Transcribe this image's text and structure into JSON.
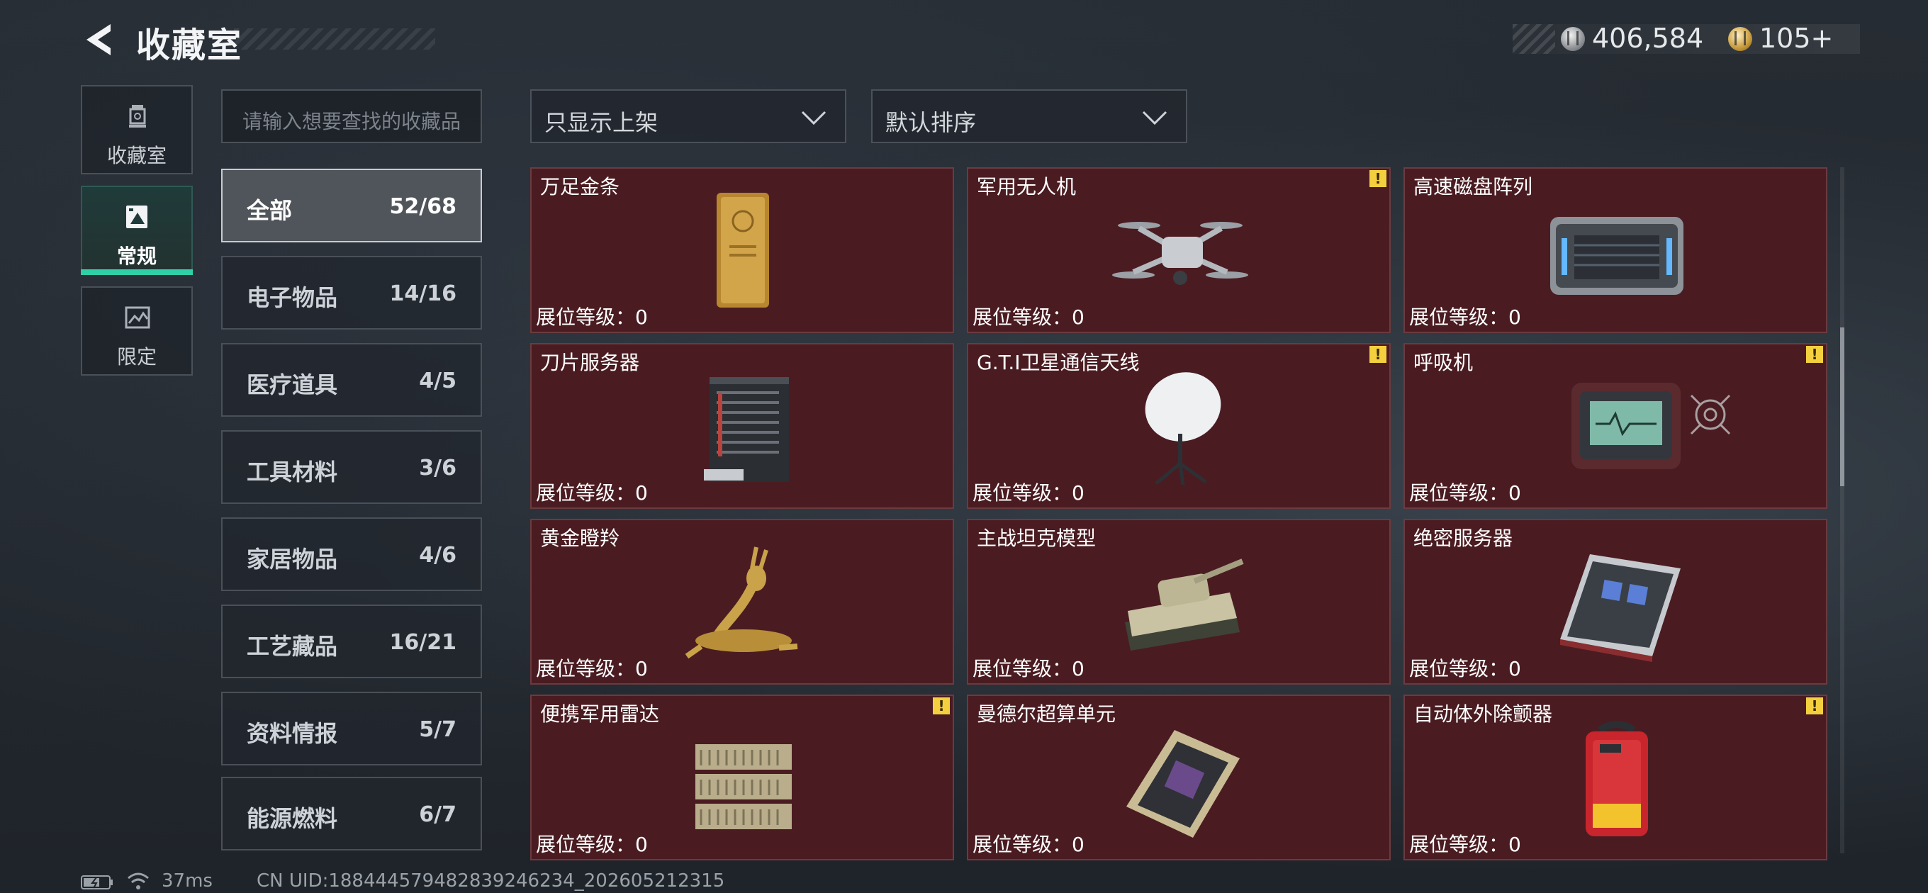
{
  "header": {
    "title": "收藏室",
    "currencies": [
      {
        "icon": "silver-coin-icon",
        "value": "406,584"
      },
      {
        "icon": "gold-coin-icon",
        "value": "105"
      }
    ],
    "add_label": "+"
  },
  "side_tabs": [
    {
      "label": "收藏室",
      "icon": "trophy-icon",
      "active": false
    },
    {
      "label": "常规",
      "icon": "gallery-icon",
      "active": true
    },
    {
      "label": "限定",
      "icon": "limited-icon",
      "active": false
    }
  ],
  "search": {
    "placeholder": "请输入想要查找的收藏品"
  },
  "categories": [
    {
      "name": "全部",
      "count": "52/68",
      "selected": true
    },
    {
      "name": "电子物品",
      "count": "14/16"
    },
    {
      "name": "医疗道具",
      "count": "4/5"
    },
    {
      "name": "工具材料",
      "count": "3/6"
    },
    {
      "name": "家居物品",
      "count": "4/6"
    },
    {
      "name": "工艺藏品",
      "count": "16/21"
    },
    {
      "name": "资料情报",
      "count": "5/7"
    },
    {
      "name": "能源燃料",
      "count": "6/7"
    }
  ],
  "filters": {
    "display": "只显示上架",
    "sort": "默认排序"
  },
  "items": [
    {
      "name": "万足金条",
      "level": "展位等级：0",
      "warning": false
    },
    {
      "name": "军用无人机",
      "level": "展位等级：0",
      "warning": true
    },
    {
      "name": "高速磁盘阵列",
      "level": "展位等级：0",
      "warning": false
    },
    {
      "name": "刀片服务器",
      "level": "展位等级：0",
      "warning": false
    },
    {
      "name": "G.T.I卫星通信天线",
      "level": "展位等级：0",
      "warning": true
    },
    {
      "name": "呼吸机",
      "level": "展位等级：0",
      "warning": true
    },
    {
      "name": "黄金瞪羚",
      "level": "展位等级：0",
      "warning": false
    },
    {
      "name": "主战坦克模型",
      "level": "展位等级：0",
      "warning": false
    },
    {
      "name": "绝密服务器",
      "level": "展位等级：0",
      "warning": false
    },
    {
      "name": "便携军用雷达",
      "level": "展位等级：0",
      "warning": true
    },
    {
      "name": "曼德尔超算单元",
      "level": "展位等级：0",
      "warning": false
    },
    {
      "name": "自动体外除颤器",
      "level": "展位等级：0",
      "warning": true
    }
  ],
  "warning_symbol": "!",
  "status": {
    "ping": "37ms",
    "uid": "CN UID:18844457948283924623​4_202605212315"
  },
  "colors": {
    "card_bg": "#4a1c21",
    "active_tab_line": "#2fd0a6",
    "warning": "#f4d03f"
  }
}
